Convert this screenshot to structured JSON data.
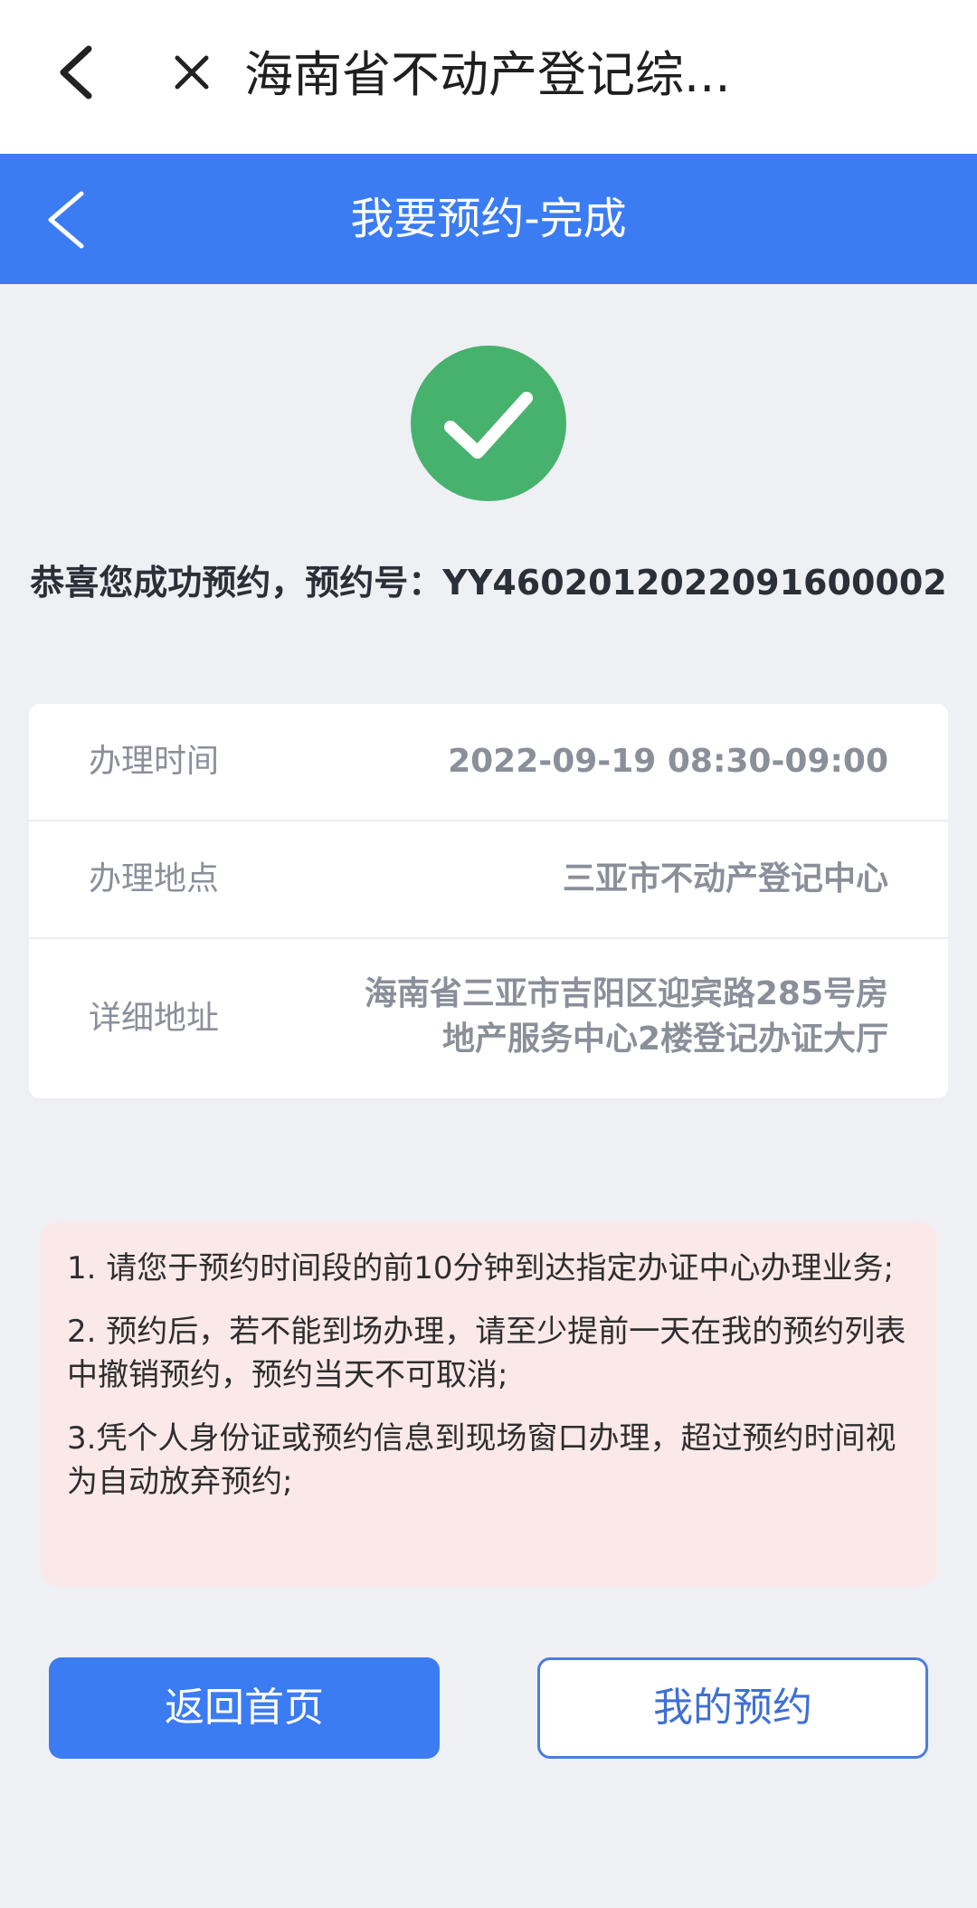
{
  "topbar": {
    "title": "海南省不动产登记综..."
  },
  "navbar": {
    "title": "我要预约-完成"
  },
  "result": {
    "message": "恭喜您成功预约，预约号：YY4602012022091600002"
  },
  "details": [
    {
      "label": "办理时间",
      "value": "2022-09-19 08:30-09:00"
    },
    {
      "label": "办理地点",
      "value": "三亚市不动产登记中心"
    },
    {
      "label": "详细地址",
      "value_line1": "海南省三亚市吉阳区迎宾路285号房",
      "value_line2": "地产服务中心2楼登记办证大厅"
    }
  ],
  "notices": [
    "1. 请您于预约时间段的前10分钟到达指定办证中心办理业务;",
    "2. 预约后，若不能到场办理，请至少提前一天在我的预约列表中撤销预约，预约当天不可取消;",
    "3.凭个人身份证或预约信息到现场窗口办理，超过预约时间视为自动放弃预约;"
  ],
  "buttons": {
    "home": "返回首页",
    "my_booking": "我的预约"
  },
  "icons": {
    "back": "chevron-left-icon",
    "close": "close-icon",
    "success": "check-circle-icon"
  },
  "colors": {
    "accent": "#3c7cf2",
    "success": "#47b26e",
    "notice_bg": "#fbe9ea"
  }
}
